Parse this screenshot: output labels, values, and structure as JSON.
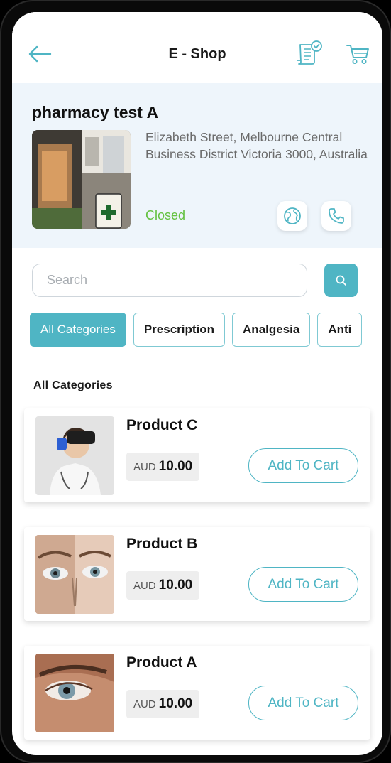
{
  "header": {
    "title": "E - Shop",
    "back_icon": "back-arrow-icon",
    "orders_icon": "order-list-icon",
    "cart_icon": "shopping-cart-icon"
  },
  "store": {
    "name": "pharmacy test A",
    "address": "Elizabeth Street, Melbourne Central Business District Victoria 3000, Australia",
    "status": "Closed",
    "status_color": "#63c13f",
    "website_icon": "globe-icon",
    "phone_icon": "phone-icon"
  },
  "search": {
    "placeholder": "Search",
    "value": "",
    "button_icon": "search-icon"
  },
  "categories": {
    "items": [
      "All Categories",
      "Prescription",
      "Analgesia",
      "Anti"
    ],
    "selected": "All Categories"
  },
  "section_title": "All Categories",
  "products": [
    {
      "name": "Product C",
      "currency": "AUD",
      "price": "10.00",
      "button": "Add To Cart"
    },
    {
      "name": "Product B",
      "currency": "AUD",
      "price": "10.00",
      "button": "Add To Cart"
    },
    {
      "name": "Product A",
      "currency": "AUD",
      "price": "10.00",
      "button": "Add To Cart"
    }
  ],
  "colors": {
    "accent": "#4fb5c4",
    "store_background": "#eef5fb"
  }
}
